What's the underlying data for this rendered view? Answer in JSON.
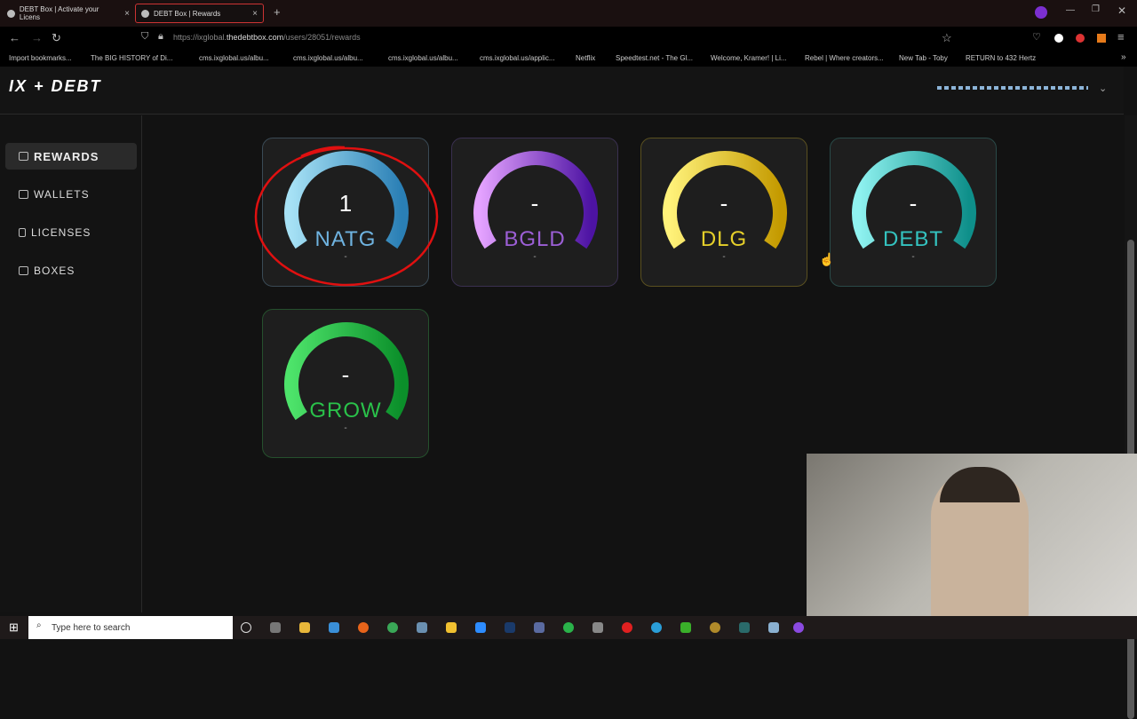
{
  "browser": {
    "tabs": [
      {
        "label": "DEBT Box | Activate your Licens"
      },
      {
        "label": "DEBT Box | Rewards",
        "active": true
      }
    ],
    "url_prefix": "https://ixglobal.",
    "url_domain": "thedebtbox.com",
    "url_path": "/users/28051/rewards",
    "bookmarks": [
      "Import bookmarks...",
      "The BIG HISTORY of Di...",
      "cms.ixglobal.us/albu...",
      "cms.ixglobal.us/albu...",
      "cms.ixglobal.us/albu...",
      "cms.ixglobal.us/applic...",
      "Netflix",
      "Speedtest.net - The Gl...",
      "Welcome, Kramer! | Li...",
      "Rebel | Where creators...",
      "New Tab - Toby",
      "RETURN to 432 Hertz"
    ]
  },
  "app": {
    "logo": "IX + DEBT"
  },
  "sidebar": {
    "items": [
      {
        "label": "REWARDS",
        "icon": "treasure-chest-icon",
        "active": true
      },
      {
        "label": "WALLETS",
        "icon": "wallet-icon"
      },
      {
        "label": "LICENSES",
        "icon": "license-icon"
      },
      {
        "label": "BOXES",
        "icon": "boxes-icon"
      }
    ]
  },
  "rewards": [
    {
      "symbol": "NATG",
      "value": "1",
      "sub": "-",
      "colors": [
        "#a6e1f5",
        "#2a7fb5"
      ],
      "text_color": "#6fb3e0",
      "border": "#3a4a55",
      "annotated": true
    },
    {
      "symbol": "BGLD",
      "value": "-",
      "sub": "-",
      "colors": [
        "#e4a2ff",
        "#4d13a3"
      ],
      "text_color": "#9c5fd6",
      "border": "#3a3050"
    },
    {
      "symbol": "DLG",
      "value": "-",
      "sub": "-",
      "colors": [
        "#fff27a",
        "#c49a00"
      ],
      "text_color": "#e6d02a",
      "border": "#5a5020"
    },
    {
      "symbol": "DEBT",
      "value": "-",
      "sub": "-",
      "colors": [
        "#8ff2f0",
        "#0e8f8a"
      ],
      "text_color": "#34c3c0",
      "border": "#2a4a48"
    },
    {
      "symbol": "GROW",
      "value": "-",
      "sub": "-",
      "colors": [
        "#4de36a",
        "#0b8f2a"
      ],
      "text_color": "#2ac24a",
      "border": "#25502d"
    }
  ],
  "taskbar": {
    "search_placeholder": "Type here to search"
  }
}
